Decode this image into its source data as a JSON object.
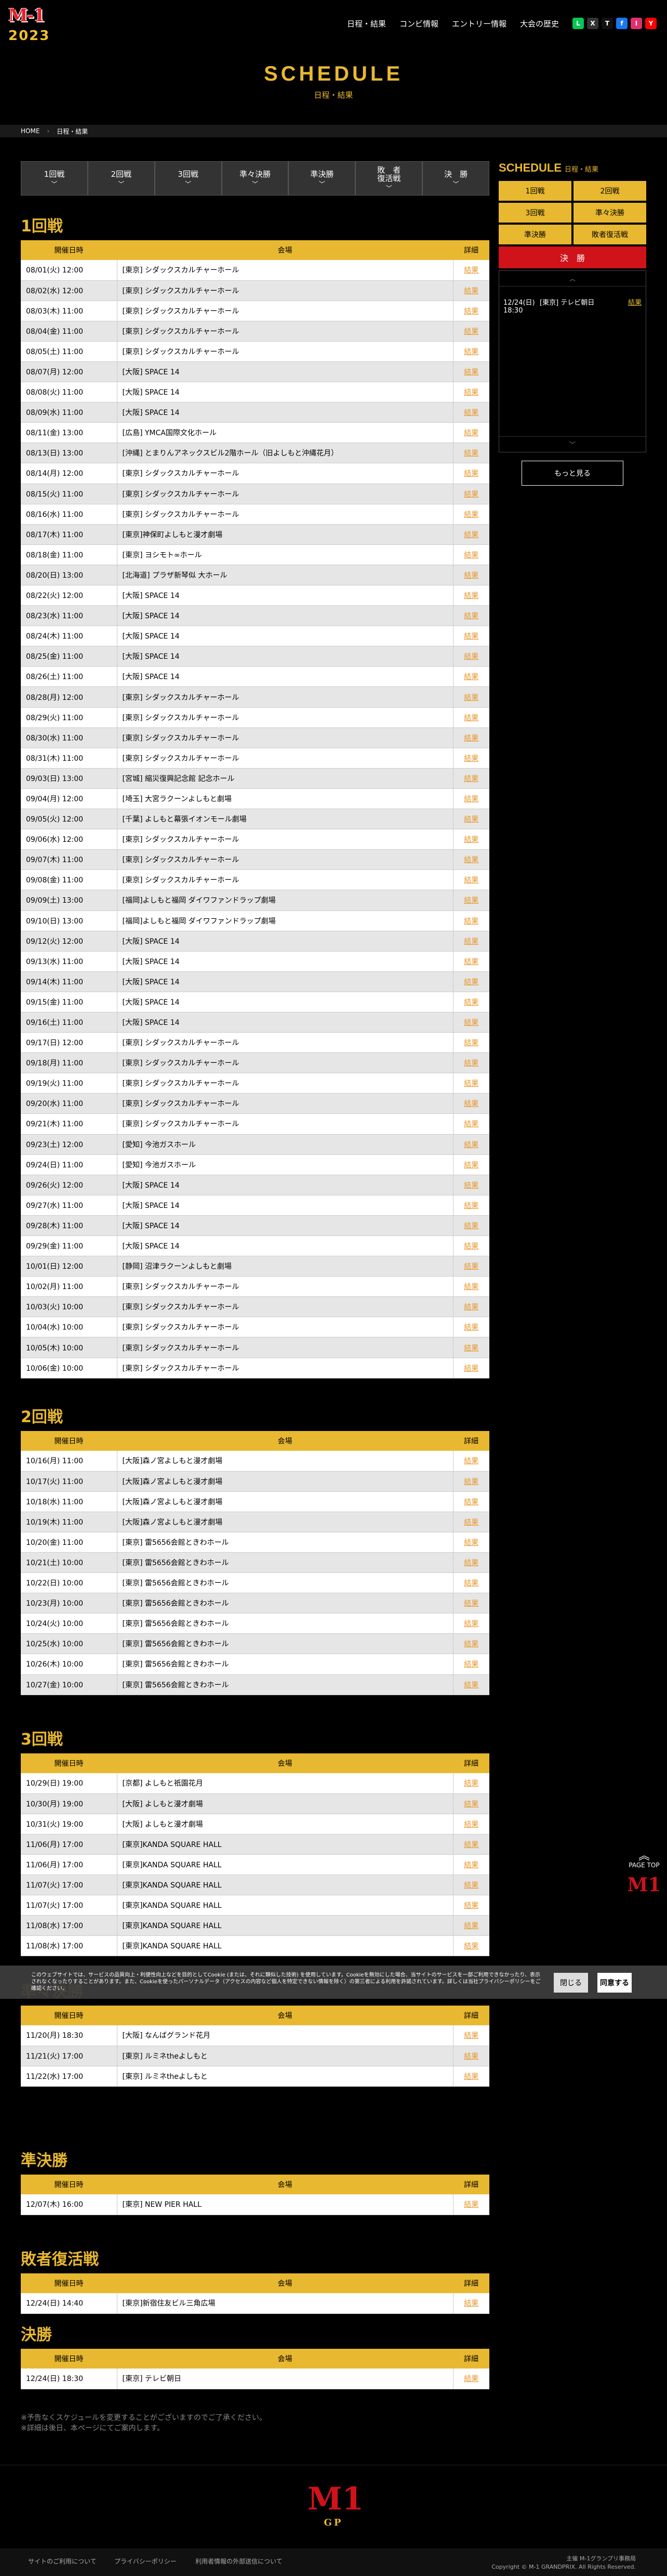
{
  "header": {
    "logo_text": "M-1",
    "logo_year": "2023",
    "nav": [
      "日程・結果",
      "コンビ情報",
      "エントリー情報",
      "大会の歴史"
    ],
    "sns": [
      "L",
      "X",
      "T",
      "f",
      "I",
      "Y"
    ],
    "sns_colors": [
      "#06c755",
      "#333333",
      "#111111",
      "#1877f2",
      "#e1306c",
      "#ff0000"
    ]
  },
  "hero": {
    "title": "SCHEDULE",
    "subtitle": "日程・結果"
  },
  "breadcrumb": [
    "HOME",
    "日程・結果"
  ],
  "tabs": [
    "1回戦",
    "2回戦",
    "3回戦",
    "準々決勝",
    "準決勝",
    "敗　者\n復活戦",
    "決　勝"
  ],
  "sidebar": {
    "title": "SCHEDULE",
    "subtitle": "日程・結果",
    "buttons": [
      "1回戦",
      "2回戦",
      "3回戦",
      "準々決勝",
      "準決勝",
      "敗者復活戦"
    ],
    "final": "決　勝",
    "entry": {
      "date": "12/24(日) 18:30",
      "place": "[東京] テレビ朝日",
      "link": "結果"
    },
    "more": "もっと見る"
  },
  "table_headers": [
    "開催日時",
    "会場",
    "詳細"
  ],
  "link_label": "結果",
  "sections": [
    {
      "title": "1回戦",
      "rows": [
        [
          "08/01(火) 12:00",
          "[東京] シダックスカルチャーホール"
        ],
        [
          "08/02(水) 12:00",
          "[東京] シダックスカルチャーホール"
        ],
        [
          "08/03(木) 11:00",
          "[東京] シダックスカルチャーホール"
        ],
        [
          "08/04(金) 11:00",
          "[東京] シダックスカルチャーホール"
        ],
        [
          "08/05(土) 11:00",
          "[東京] シダックスカルチャーホール"
        ],
        [
          "08/07(月) 12:00",
          "[大阪] SPACE 14"
        ],
        [
          "08/08(火) 11:00",
          "[大阪] SPACE 14"
        ],
        [
          "08/09(水) 11:00",
          "[大阪] SPACE 14"
        ],
        [
          "08/11(金) 13:00",
          "[広島] YMCA国際文化ホール"
        ],
        [
          "08/13(日) 13:00",
          "[沖縄] とまりんアネックスビル2階ホール（旧よしもと沖縄花月）"
        ],
        [
          "08/14(月) 12:00",
          "[東京] シダックスカルチャーホール"
        ],
        [
          "08/15(火) 11:00",
          "[東京] シダックスカルチャーホール"
        ],
        [
          "08/16(水) 11:00",
          "[東京] シダックスカルチャーホール"
        ],
        [
          "08/17(木) 11:00",
          "[東京]神保町よしもと漫才劇場"
        ],
        [
          "08/18(金) 11:00",
          "[東京] ヨシモト∞ホール"
        ],
        [
          "08/20(日) 13:00",
          "[北海道] プラザ新琴似 大ホール"
        ],
        [
          "08/22(火) 12:00",
          "[大阪] SPACE 14"
        ],
        [
          "08/23(水) 11:00",
          "[大阪] SPACE 14"
        ],
        [
          "08/24(木) 11:00",
          "[大阪] SPACE 14"
        ],
        [
          "08/25(金) 11:00",
          "[大阪] SPACE 14"
        ],
        [
          "08/26(土) 11:00",
          "[大阪] SPACE 14"
        ],
        [
          "08/28(月) 12:00",
          "[東京] シダックスカルチャーホール"
        ],
        [
          "08/29(火) 11:00",
          "[東京] シダックスカルチャーホール"
        ],
        [
          "08/30(水) 11:00",
          "[東京] シダックスカルチャーホール"
        ],
        [
          "08/31(木) 11:00",
          "[東京] シダックスカルチャーホール"
        ],
        [
          "09/03(日) 13:00",
          "[宮城] 縮災復興記念館 記念ホール"
        ],
        [
          "09/04(月) 12:00",
          "[埼玉] 大宮ラクーンよしもと劇場"
        ],
        [
          "09/05(火) 12:00",
          "[千葉] よしもと幕張イオンモール劇場"
        ],
        [
          "09/06(水) 12:00",
          "[東京] シダックスカルチャーホール"
        ],
        [
          "09/07(木) 11:00",
          "[東京] シダックスカルチャーホール"
        ],
        [
          "09/08(金) 11:00",
          "[東京] シダックスカルチャーホール"
        ],
        [
          "09/09(土) 13:00",
          "[福岡]よしもと福岡 ダイワファンドラップ劇場"
        ],
        [
          "09/10(日) 13:00",
          "[福岡]よしもと福岡 ダイワファンドラップ劇場"
        ],
        [
          "09/12(火) 12:00",
          "[大阪] SPACE 14"
        ],
        [
          "09/13(水) 11:00",
          "[大阪] SPACE 14"
        ],
        [
          "09/14(木) 11:00",
          "[大阪] SPACE 14"
        ],
        [
          "09/15(金) 11:00",
          "[大阪] SPACE 14"
        ],
        [
          "09/16(土) 11:00",
          "[大阪] SPACE 14"
        ],
        [
          "09/17(日) 12:00",
          "[東京] シダックスカルチャーホール"
        ],
        [
          "09/18(月) 11:00",
          "[東京] シダックスカルチャーホール"
        ],
        [
          "09/19(火) 11:00",
          "[東京] シダックスカルチャーホール"
        ],
        [
          "09/20(水) 11:00",
          "[東京] シダックスカルチャーホール"
        ],
        [
          "09/21(木) 11:00",
          "[東京] シダックスカルチャーホール"
        ],
        [
          "09/23(土) 12:00",
          "[愛知] 今池ガスホール"
        ],
        [
          "09/24(日) 11:00",
          "[愛知] 今池ガスホール"
        ],
        [
          "09/26(火) 12:00",
          "[大阪] SPACE 14"
        ],
        [
          "09/27(水) 11:00",
          "[大阪] SPACE 14"
        ],
        [
          "09/28(木) 11:00",
          "[大阪] SPACE 14"
        ],
        [
          "09/29(金) 11:00",
          "[大阪] SPACE 14"
        ],
        [
          "10/01(日) 12:00",
          "[静岡] 沼津ラクーンよしもと劇場"
        ],
        [
          "10/02(月) 11:00",
          "[東京] シダックスカルチャーホール"
        ],
        [
          "10/03(火) 10:00",
          "[東京] シダックスカルチャーホール"
        ],
        [
          "10/04(水) 10:00",
          "[東京] シダックスカルチャーホール"
        ],
        [
          "10/05(木) 10:00",
          "[東京] シダックスカルチャーホール"
        ],
        [
          "10/06(金) 10:00",
          "[東京] シダックスカルチャーホール"
        ]
      ]
    },
    {
      "title": "2回戦",
      "rows": [
        [
          "10/16(月) 11:00",
          "[大阪]森ノ宮よしもと漫才劇場"
        ],
        [
          "10/17(火) 11:00",
          "[大阪]森ノ宮よしもと漫才劇場"
        ],
        [
          "10/18(水) 11:00",
          "[大阪]森ノ宮よしもと漫才劇場"
        ],
        [
          "10/19(木) 11:00",
          "[大阪]森ノ宮よしもと漫才劇場"
        ],
        [
          "10/20(金) 11:00",
          "[東京] 雷5656会館ときわホール"
        ],
        [
          "10/21(土) 10:00",
          "[東京] 雷5656会館ときわホール"
        ],
        [
          "10/22(日) 10:00",
          "[東京] 雷5656会館ときわホール"
        ],
        [
          "10/23(月) 10:00",
          "[東京] 雷5656会館ときわホール"
        ],
        [
          "10/24(火) 10:00",
          "[東京] 雷5656会館ときわホール"
        ],
        [
          "10/25(水) 10:00",
          "[東京] 雷5656会館ときわホール"
        ],
        [
          "10/26(木) 10:00",
          "[東京] 雷5656会館ときわホール"
        ],
        [
          "10/27(金) 10:00",
          "[東京] 雷5656会館ときわホール"
        ]
      ]
    },
    {
      "title": "3回戦",
      "rows": [
        [
          "10/29(日) 19:00",
          "[京都] よしもと祇園花月"
        ],
        [
          "10/30(月) 19:00",
          "[大阪] よしもと漫才劇場"
        ],
        [
          "10/31(火) 19:00",
          "[大阪] よしもと漫才劇場"
        ],
        [
          "11/06(月) 17:00",
          "[東京]KANDA SQUARE HALL"
        ],
        [
          "11/06(月) 17:00",
          "[東京]KANDA SQUARE HALL"
        ],
        [
          "11/07(火) 17:00",
          "[東京]KANDA SQUARE HALL"
        ],
        [
          "11/07(火) 17:00",
          "[東京]KANDA SQUARE HALL"
        ],
        [
          "11/08(水) 17:00",
          "[東京]KANDA SQUARE HALL"
        ],
        [
          "11/08(水) 17:00",
          "[東京]KANDA SQUARE HALL"
        ]
      ]
    },
    {
      "title": "準々決勝",
      "rows": [
        [
          "11/20(月) 18:30",
          "[大阪] なんばグランド花月"
        ],
        [
          "11/21(火) 17:00",
          "[東京] ルミネtheよしもと"
        ],
        [
          "11/22(水) 17:00",
          "[東京] ルミネtheよしもと"
        ]
      ]
    },
    {
      "title": "準決勝",
      "rows": [
        [
          "12/07(木) 16:00",
          "[東京] NEW PIER HALL"
        ]
      ]
    },
    {
      "title": "敗者復活戦",
      "rows": [
        [
          "12/24(日) 14:40",
          "[東京]新宿住友ビル三角広場"
        ]
      ]
    },
    {
      "title": "決勝",
      "rows": [
        [
          "12/24(日) 18:30",
          "[東京] テレビ朝日"
        ]
      ]
    }
  ],
  "cookie": {
    "text": "このウェブサイトでは、サービスの品質向上・利便性向上などを目的としてCookie (または、それに類似した技術) を使用しています。Cookieを無効にした場合、当サイトのサービスを一部ご利用できなかったり、表示されなくなったりすることがあります。また、Cookieを使ったパーソナルデータ（アクセスの内容など個人を特定できない情報を除く）の第三者による利用を許諾されています。詳しくは当社プライバシーポリシーをご確認ください。",
    "decline": "閉じる",
    "accept": "同意する"
  },
  "pagetop": "PAGE TOP",
  "notes": [
    "※予告なくスケジュールを変更することがございますのでご了承ください。",
    "※詳細は後日、本ページにてご案内します。"
  ],
  "footer": {
    "logo": "M1",
    "logo_sub": "GP",
    "links": [
      "サイトのご利用について",
      "プライバシーポリシー",
      "利用者情報の外部送信について"
    ],
    "org": "主催 M-1グランプリ事務局",
    "copyright": "Copyright © M-1 GRANDPRIX. All Rights Reserved."
  }
}
